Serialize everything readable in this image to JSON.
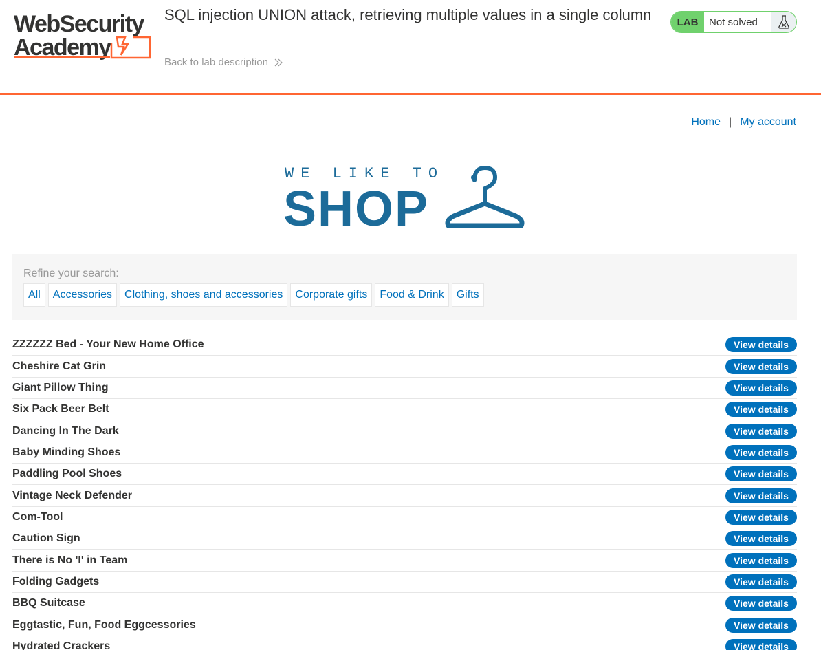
{
  "header": {
    "lab_title": "SQL injection UNION attack, retrieving multiple values in a single column",
    "back_link": "Back to lab description",
    "logo_icon": "web-security-academy-logo",
    "status": {
      "badge": "LAB",
      "state": "Not solved",
      "icon": "flask-icon"
    }
  },
  "nav": {
    "home": "Home",
    "separator": "|",
    "account": "My account"
  },
  "banner": {
    "icon": "we-like-to-shop-banner"
  },
  "filters": {
    "label": "Refine your search:",
    "categories": [
      "All",
      "Accessories",
      "Clothing, shoes and accessories",
      "Corporate gifts",
      "Food & Drink",
      "Gifts"
    ]
  },
  "products": [
    {
      "name": "ZZZZZZ Bed - Your New Home Office",
      "action": "View details"
    },
    {
      "name": "Cheshire Cat Grin",
      "action": "View details"
    },
    {
      "name": "Giant Pillow Thing",
      "action": "View details"
    },
    {
      "name": "Six Pack Beer Belt",
      "action": "View details"
    },
    {
      "name": "Dancing In The Dark",
      "action": "View details"
    },
    {
      "name": "Baby Minding Shoes",
      "action": "View details"
    },
    {
      "name": "Paddling Pool Shoes",
      "action": "View details"
    },
    {
      "name": "Vintage Neck Defender",
      "action": "View details"
    },
    {
      "name": "Com-Tool",
      "action": "View details"
    },
    {
      "name": "Caution Sign",
      "action": "View details"
    },
    {
      "name": "There is No 'I' in Team",
      "action": "View details"
    },
    {
      "name": "Folding Gadgets",
      "action": "View details"
    },
    {
      "name": "BBQ Suitcase",
      "action": "View details"
    },
    {
      "name": "Eggtastic, Fun, Food Eggcessories",
      "action": "View details"
    },
    {
      "name": "Hydrated Crackers",
      "action": "View details"
    }
  ],
  "colors": {
    "accent_orange": "#ff6633",
    "link_blue": "#0071bc",
    "lab_green": "#70d16d",
    "banner_blue": "#1c6b99"
  }
}
